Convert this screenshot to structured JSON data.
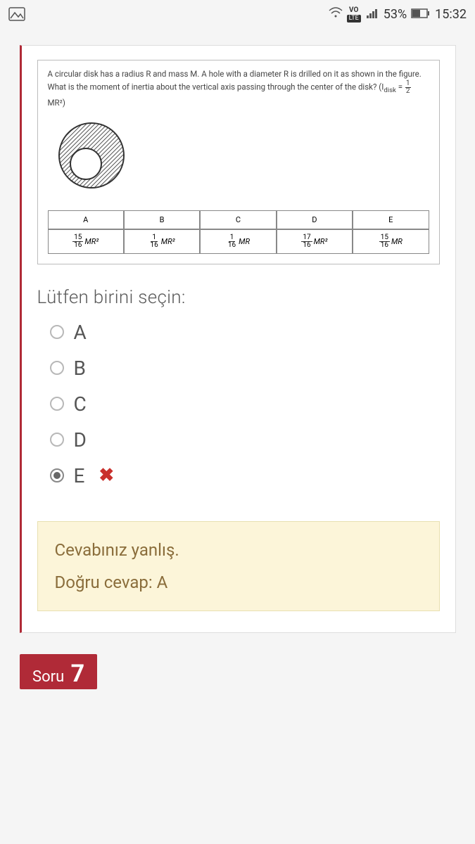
{
  "statusbar": {
    "vo": "VO",
    "lte": "LTE",
    "battery_percent": "53%",
    "time": "15:32"
  },
  "question": {
    "text_line1": "A circular disk has a radius R and mass M. A hole with a diameter R is drilled on it as shown in the figure. What is the moment of inertia about the vertical axis passing through the center of the disk? (I",
    "text_sub": "disk",
    "text_eq": " = ",
    "frac_top": "1",
    "frac_bot": "2",
    "text_after": "MR²)"
  },
  "options_header": {
    "A": "A",
    "B": "B",
    "C": "C",
    "D": "D",
    "E": "E"
  },
  "options": {
    "A": {
      "num": "15",
      "den": "16",
      "term": "MR²"
    },
    "B": {
      "num": "1",
      "den": "16",
      "term": "MR²"
    },
    "C": {
      "num": "1",
      "den": "16",
      "term": "MR"
    },
    "D": {
      "num": "17",
      "den": "16",
      "term": "MR²"
    },
    "E": {
      "num": "15",
      "den": "16",
      "term": "MR"
    }
  },
  "choose_label": "Lütfen birini seçin:",
  "choices": {
    "A": "A",
    "B": "B",
    "C": "C",
    "D": "D",
    "E": "E"
  },
  "wrong_mark": "✖",
  "feedback": {
    "wrong": "Cevabınız yanlış.",
    "correct_prefix": "Doğru cevap: ",
    "correct_letter": "A"
  },
  "next_question": {
    "label": "Soru",
    "number": "7"
  }
}
